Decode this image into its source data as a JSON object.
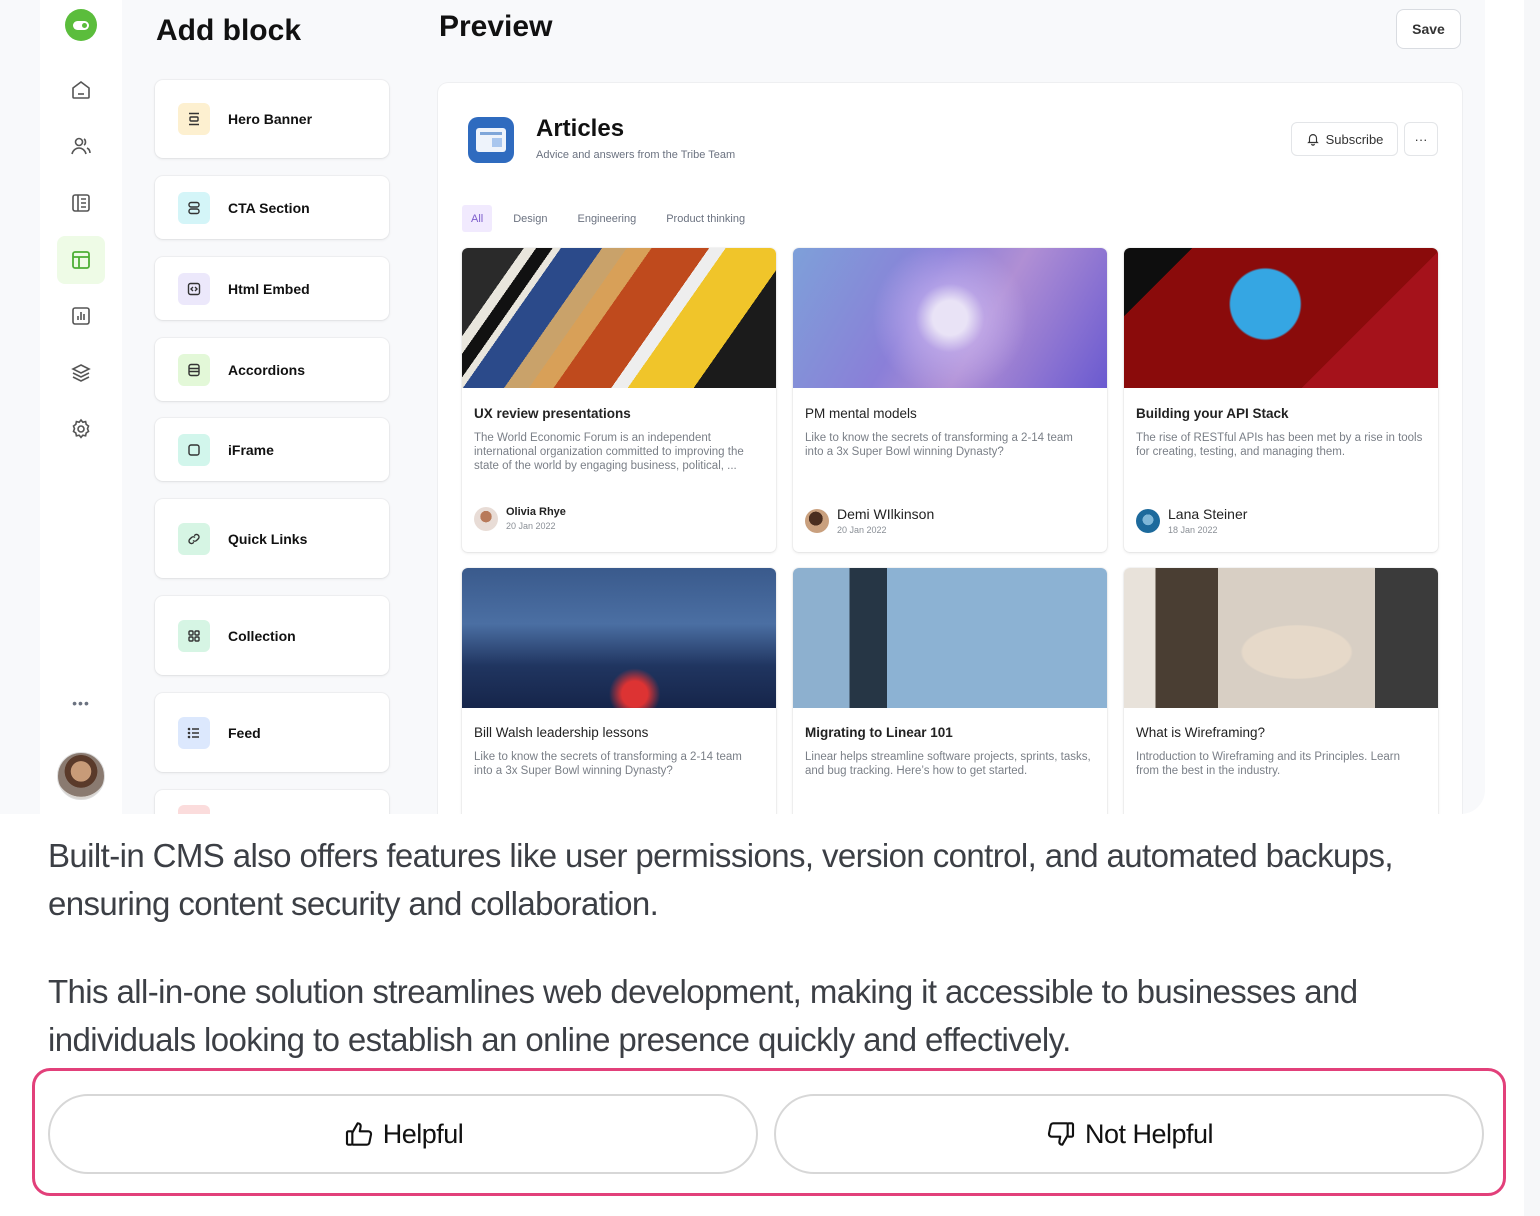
{
  "sidebar": {
    "items": [
      {
        "icon": "home-icon"
      },
      {
        "icon": "users-icon"
      },
      {
        "icon": "book-icon"
      },
      {
        "icon": "layout-icon",
        "active": true
      },
      {
        "icon": "chart-icon"
      },
      {
        "icon": "layers-icon"
      },
      {
        "icon": "gear-icon"
      }
    ],
    "more_label": "•••"
  },
  "add_block": {
    "title": "Add block",
    "blocks": [
      {
        "label": "Hero Banner",
        "icon": "hero-banner-icon",
        "color": "#fdf0d0"
      },
      {
        "label": "CTA Section",
        "icon": "cta-section-icon",
        "color": "#d4f5f8"
      },
      {
        "label": "Html Embed",
        "icon": "code-icon",
        "color": "#ece8fb"
      },
      {
        "label": "Accordions",
        "icon": "accordion-icon",
        "color": "#e3f8d8"
      },
      {
        "label": "iFrame",
        "icon": "square-icon",
        "color": "#d2f6ec"
      },
      {
        "label": "Quick Links",
        "icon": "link-icon",
        "color": "#d6f5e4"
      },
      {
        "label": "Collection",
        "icon": "grid-icon",
        "color": "#d6f5e4"
      },
      {
        "label": "Feed",
        "icon": "list-icon",
        "color": "#dce8fd"
      }
    ]
  },
  "preview": {
    "title": "Preview",
    "save_label": "Save",
    "space": {
      "title": "Articles",
      "subtitle": "Advice and answers from the Tribe Team",
      "subscribe_label": "Subscribe",
      "more_label": "···"
    },
    "tabs": [
      "All",
      "Design",
      "Engineering",
      "Product thinking"
    ],
    "articles": [
      {
        "title": "UX review presentations",
        "desc": "The World Economic Forum is an independent international organization committed to improving the state of the world by engaging business, political, ...",
        "author": "Olivia Rhye",
        "date": "20 Jan 2022"
      },
      {
        "title": "PM mental models",
        "desc": "Like to know the secrets of transforming a 2-14 team into a 3x Super Bowl winning Dynasty?",
        "author": "Demi WIlkinson",
        "date": "20 Jan 2022"
      },
      {
        "title": "Building your API Stack",
        "desc": "The rise of RESTful APIs has been met by a rise in tools for creating, testing, and managing them.",
        "author": "Lana Steiner",
        "date": "18 Jan 2022"
      },
      {
        "title": "Bill Walsh leadership lessons",
        "desc": "Like to know the secrets of transforming a 2-14 team into a 3x Super Bowl winning Dynasty?"
      },
      {
        "title": "Migrating to Linear 101",
        "desc": "Linear helps streamline software projects, sprints, tasks, and bug tracking. Here’s how to get started."
      },
      {
        "title": "What is Wireframing?",
        "desc": "Introduction to Wireframing and its Principles. Learn from the best in the industry."
      }
    ]
  },
  "article": {
    "paragraphs": [
      "Built-in CMS also offers features like user permissions, version control, and automated backups, ensuring content security and collaboration.",
      "This all-in-one solution streamlines web development, making it accessible to businesses and individuals looking to establish an online presence quickly and effectively."
    ]
  },
  "feedback": {
    "helpful_label": "Helpful",
    "not_helpful_label": "Not Helpful",
    "highlight_color": "#e2407a"
  }
}
